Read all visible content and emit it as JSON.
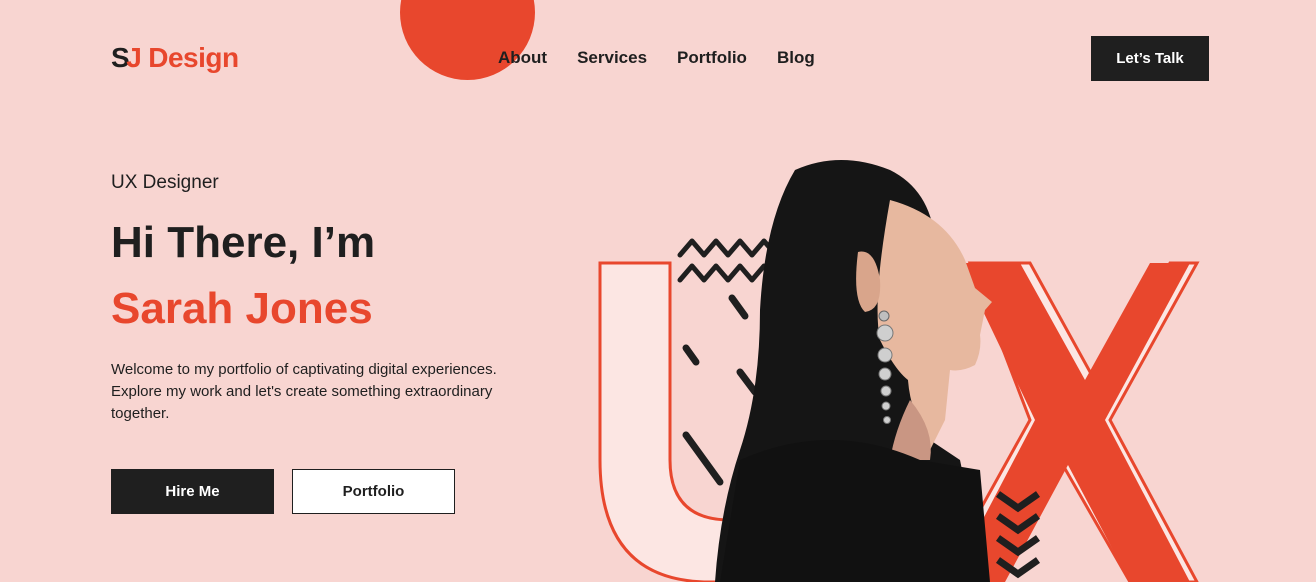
{
  "brand": {
    "logo_s": "S",
    "logo_j": "J",
    "logo_word": "Design"
  },
  "nav": {
    "items": [
      "About",
      "Services",
      "Portfolio",
      "Blog"
    ]
  },
  "header": {
    "cta_label": "Let’s Talk"
  },
  "hero": {
    "role": "UX Designer",
    "greeting": "Hi There, I’m",
    "name": "Sarah Jones",
    "description": "Welcome to my portfolio of captivating digital experiences. Explore my work and let's create something extraordinary together.",
    "primary_button": "Hire Me",
    "secondary_button": "Portfolio"
  },
  "colors": {
    "background": "#f8d5d1",
    "accent": "#e8472d",
    "dark": "#1f1f1f",
    "light_fill": "#fce6e3"
  },
  "icons": [
    "decorative-circle",
    "zigzag-icon",
    "chevron-stack-icon"
  ]
}
